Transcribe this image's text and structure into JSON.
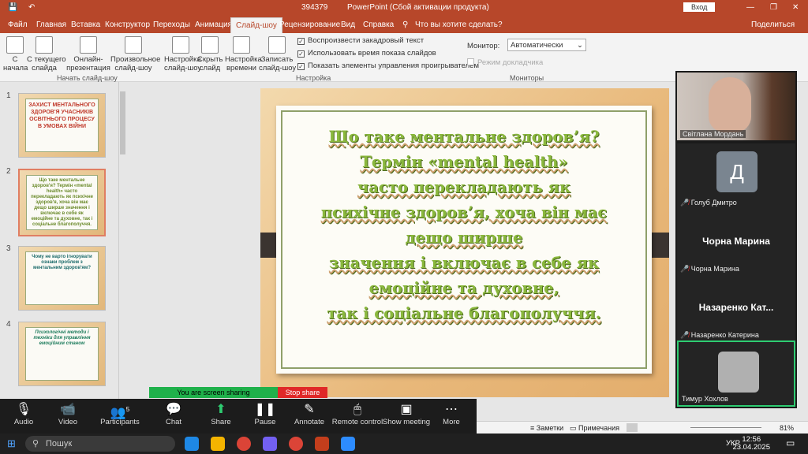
{
  "titlebar": {
    "filename": "394379",
    "app": "PowerPoint (Сбой активации продукта)",
    "signin": "Вход",
    "share": "Поделиться"
  },
  "tabs": [
    "Файл",
    "Главная",
    "Вставка",
    "Конструктор",
    "Переходы",
    "Анимация",
    "Слайд-шоу",
    "Рецензирование",
    "Вид",
    "Справка",
    "Что вы хотите сделать?"
  ],
  "ribbon": {
    "from_start": "С\nначала",
    "from_current": "С текущего\nслайда",
    "online": "Онлайн-\nпрезентация",
    "custom": "Произвольное\nслайд-шоу",
    "group1": "Начать слайд-шоу",
    "setup": "Настройка\nслайд-шоу",
    "hide": "Скрыть\nслайд",
    "rehearse": "Настройка\nвремени",
    "record": "Записать\nслайд-шоу",
    "check1": "Воспроизвести закадровый текст",
    "check2": "Использовать время показа слайдов",
    "check3": "Показать элементы управления проигрывателем",
    "group2": "Настройка",
    "monitor_label": "Монитор:",
    "monitor_value": "Автоматически",
    "presenter": "Режим докладчика",
    "group3": "Мониторы"
  },
  "thumbs": [
    {
      "num": "1",
      "text": "ЗАХИСТ МЕНТАЛЬНОГО ЗДОРОВ'Я УЧАСНИКІВ ОСВІТНЬОГО ПРОЦЕСУ В УМОВАХ ВІЙНИ"
    },
    {
      "num": "2",
      "text": "Що таке ментальне здоров'я? Термін «mental health» часто перекладають як психічне здоров'я, хоча він має дещо ширше значення і включає в себе як емоційне та духовне, так і соціальне благополуччя."
    },
    {
      "num": "3",
      "text": "Чому не варто ігнорувати ознаки проблем з ментальним здоров'ям?"
    },
    {
      "num": "4",
      "text": "Психологічні методи і техніки для управління емоційним станом"
    }
  ],
  "slide_lines": [
    "Що таке ментальне здоров’я?",
    "Термін «mental health»",
    "часто перекладають як",
    "психічне здоров’я, хоча він має",
    "дещо ширше",
    "значення і включає в себе як",
    "емоційне та духовне,",
    "так і соціальне благополуччя."
  ],
  "participants": [
    {
      "name": "Світлана Мордань"
    },
    {
      "name": "Голуб Дмитро",
      "initial": "Д"
    },
    {
      "name": "Чорна Марина",
      "big": "Чорна Марина"
    },
    {
      "name": "Назаренко Катерина",
      "big": "Назаренко  Кат..."
    },
    {
      "name": "Тимур Хохлов"
    }
  ],
  "zoom_toolbar": {
    "audio": "Audio",
    "video": "Video",
    "participants": "Participants",
    "participants_count": "5",
    "chat": "Chat",
    "share": "Share",
    "pause": "Pause",
    "annotate": "Annotate",
    "remote": "Remote control",
    "show": "Show meeting",
    "more": "More"
  },
  "sharebar": {
    "sharing": "You are screen sharing",
    "stop": "Stop share"
  },
  "status": {
    "notes": "Заметки",
    "comments": "Примечания",
    "zoom": "81%"
  },
  "taskbar": {
    "search": "Пошук",
    "lang": "УКР",
    "time": "12:56",
    "date": "23.04.2025"
  },
  "colors": {
    "accent": "#b7472a",
    "slide_text": "#8ab83d"
  }
}
